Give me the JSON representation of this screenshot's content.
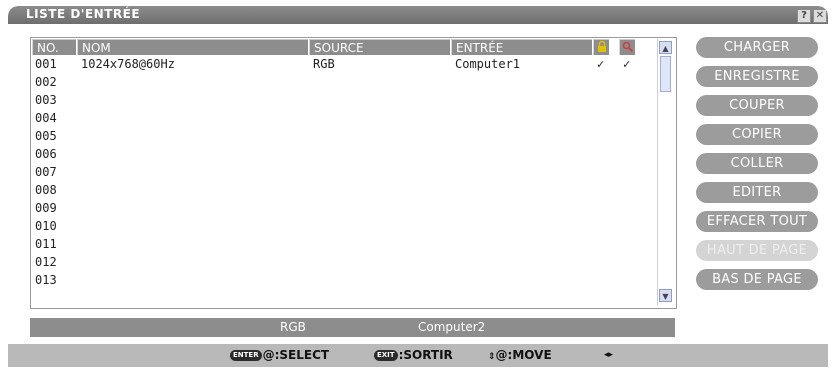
{
  "window": {
    "title": "LISTE D'ENTRÉE",
    "help_label": "?",
    "close_label": "✕"
  },
  "table": {
    "columns": {
      "no": "NO.",
      "nom": "NOM",
      "source": "SOURCE",
      "entree": "ENTRÉE",
      "lock_icon": "lock-icon",
      "search_icon": "search-icon"
    },
    "rows": [
      {
        "no": "001",
        "nom": "1024x768@60Hz",
        "source": "RGB",
        "entree": "Computer1",
        "lock": "✓",
        "search": "✓"
      },
      {
        "no": "002",
        "nom": "",
        "source": "",
        "entree": "",
        "lock": "",
        "search": ""
      },
      {
        "no": "003",
        "nom": "",
        "source": "",
        "entree": "",
        "lock": "",
        "search": ""
      },
      {
        "no": "004",
        "nom": "",
        "source": "",
        "entree": "",
        "lock": "",
        "search": ""
      },
      {
        "no": "005",
        "nom": "",
        "source": "",
        "entree": "",
        "lock": "",
        "search": ""
      },
      {
        "no": "006",
        "nom": "",
        "source": "",
        "entree": "",
        "lock": "",
        "search": ""
      },
      {
        "no": "007",
        "nom": "",
        "source": "",
        "entree": "",
        "lock": "",
        "search": ""
      },
      {
        "no": "008",
        "nom": "",
        "source": "",
        "entree": "",
        "lock": "",
        "search": ""
      },
      {
        "no": "009",
        "nom": "",
        "source": "",
        "entree": "",
        "lock": "",
        "search": ""
      },
      {
        "no": "010",
        "nom": "",
        "source": "",
        "entree": "",
        "lock": "",
        "search": ""
      },
      {
        "no": "011",
        "nom": "",
        "source": "",
        "entree": "",
        "lock": "",
        "search": ""
      },
      {
        "no": "012",
        "nom": "",
        "source": "",
        "entree": "",
        "lock": "",
        "search": ""
      },
      {
        "no": "013",
        "nom": "",
        "source": "",
        "entree": "",
        "lock": "",
        "search": ""
      }
    ]
  },
  "status": {
    "source": "RGB",
    "entree": "Computer2"
  },
  "buttons": {
    "charger": "CHARGER",
    "enregistre": "ENREGISTRE",
    "couper": "COUPER",
    "copier": "COPIER",
    "coller": "COLLER",
    "editer": "EDITER",
    "effacer_tout": "EFFACER TOUT",
    "haut_de_page": "HAUT DE PAGE",
    "bas_de_page": "BAS DE PAGE"
  },
  "hints": {
    "enter_key": "ENTER",
    "select": "@:SELECT",
    "exit_key": "EXIT",
    "sortir": ":SORTIR",
    "move": "@:MOVE"
  },
  "colors": {
    "header_gray": "#8d8d8d",
    "button_gray": "#9c9c9c",
    "button_disabled": "#d4d4d4",
    "lock_icon": "#d8b400",
    "search_icon": "#d23a3a"
  }
}
